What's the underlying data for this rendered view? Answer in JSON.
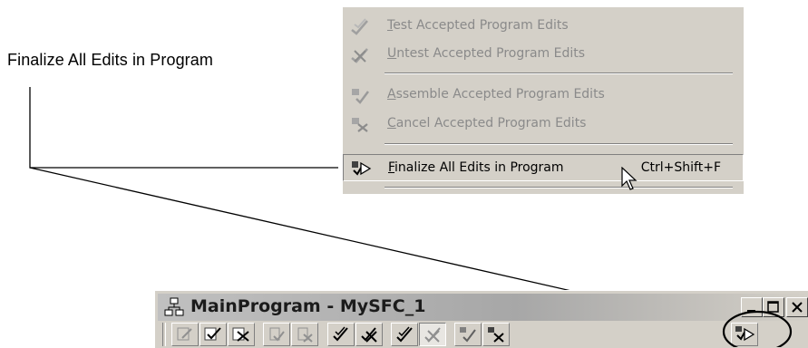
{
  "callout": {
    "text": "Finalize All Edits in Program"
  },
  "menu": {
    "items": [
      {
        "label_first": "T",
        "label_rest": "est Accepted Program Edits",
        "icon": "test-edits-icon",
        "enabled": false
      },
      {
        "label_first": "U",
        "label_rest": "ntest Accepted Program Edits",
        "icon": "untest-edits-icon",
        "enabled": false
      },
      {
        "label_first": "A",
        "label_rest": "ssemble Accepted Program Edits",
        "icon": "assemble-edits-icon",
        "enabled": false
      },
      {
        "label_first": "C",
        "label_rest": "ancel Accepted Program Edits",
        "icon": "cancel-edits-icon",
        "enabled": false
      },
      {
        "label_first": "F",
        "label_rest": "inalize All Edits in Program",
        "shortcut": "Ctrl+Shift+F",
        "icon": "finalize-edits-icon",
        "enabled": true
      }
    ]
  },
  "window": {
    "title": "MainProgram - MySFC_1",
    "toolbar_buttons": [
      "edit-icon",
      "accept-pending-edits-icon",
      "cancel-pending-edits-icon",
      "assemble-icon",
      "cancel-assemble-icon",
      "accept-program-edits-icon",
      "cancel-program-edits-icon",
      "test-accepted-edits-icon",
      "untest-accepted-edits-icon",
      "assemble-accepted-edits-icon",
      "cancel-accepted-edits-icon",
      "finalize-all-edits-icon"
    ]
  },
  "colors": {
    "menu_bg": "#d4d0c8",
    "disabled_text": "#8a8a8a",
    "titlebar": "#a7a7a7"
  }
}
